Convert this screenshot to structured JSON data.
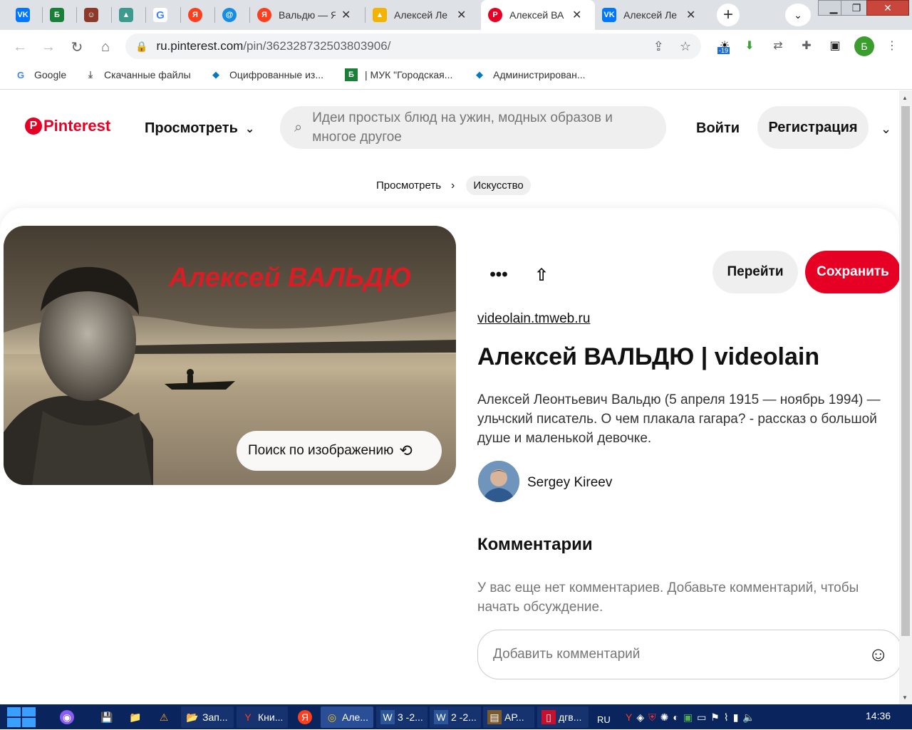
{
  "browser": {
    "tabs": [
      {
        "icon": "vk-icon",
        "label": "",
        "color": "#0077ff"
      },
      {
        "icon": "b-green-icon",
        "label": "",
        "color": "#1a7f37"
      },
      {
        "icon": "portrait-icon",
        "label": "",
        "color": "#8b3a2a"
      },
      {
        "icon": "landscape-icon",
        "label": "",
        "color": "#3c9a8f"
      },
      {
        "icon": "google-icon",
        "label": "",
        "color": "#4285f4"
      },
      {
        "icon": "yandex-icon",
        "label": "",
        "color": "#fc3f1d"
      },
      {
        "icon": "mail-at-icon",
        "label": "",
        "color": "#168de2"
      },
      {
        "icon": "yandex-icon",
        "label": "Вальдю — Я",
        "color": "#fc3f1d"
      },
      {
        "icon": "image-icon",
        "label": "Алексей Ле",
        "color": "#f2b400"
      },
      {
        "icon": "pinterest-icon",
        "label": "Алексей ВА",
        "color": "#e60023"
      },
      {
        "icon": "vk-icon",
        "label": "Алексей Ле",
        "color": "#0077ff"
      }
    ],
    "url_host": "ru.pinterest.com",
    "url_path": "/pin/362328732503803906/",
    "extension_badge": "-19",
    "profile_initial": "Б",
    "bookmarks": [
      {
        "icon": "google-icon",
        "label": "Google"
      },
      {
        "icon": "download-icon",
        "label": "Скачанные файлы"
      },
      {
        "icon": "drupal-icon",
        "label": "Оцифрованные из..."
      },
      {
        "icon": "b-green-icon",
        "label": "| МУК \"Городская..."
      },
      {
        "icon": "drupal-icon",
        "label": "Администрирован..."
      }
    ]
  },
  "pinterest": {
    "brand": "Pinterest",
    "explore_label": "Просмотреть",
    "search_placeholder": "Идеи простых блюд на ужин, модных образов и многое другое",
    "login_label": "Войти",
    "signup_label": "Регистрация",
    "breadcrumb": [
      "Просмотреть",
      "Искусство"
    ],
    "image_overlay_text": "Алексей ВАЛЬДЮ",
    "image_search_label": "Поиск по изображению",
    "goto_label": "Перейти",
    "save_label": "Сохранить",
    "source_link": "videolain.tmweb.ru",
    "pin_title": "Алексей ВАЛЬДЮ | videolain",
    "pin_description": "Алексей Леонтьевич Вальдю (5 апреля 1915 — ноябрь 1994) — ульчский писатель. О чем плакала гагара? - рассказ о большой душе и маленькой девочке.",
    "author": "Sergey Kireev",
    "comments_heading": "Комментарии",
    "no_comments_text": "У вас еще нет комментариев. Добавьте комментарий, чтобы начать обсуждение.",
    "add_comment_placeholder": "Добавить комментарий",
    "accent_color": "#e60023"
  },
  "taskbar": {
    "items": [
      {
        "icon": "folder-icon",
        "label": "Зап..."
      },
      {
        "icon": "yandex-browser-icon",
        "label": "Кни..."
      },
      {
        "icon": "yandex-icon",
        "label": ""
      },
      {
        "icon": "chrome-icon",
        "label": "Але..."
      },
      {
        "icon": "word-icon",
        "label": "3 -2..."
      },
      {
        "icon": "word-icon",
        "label": "2 -2..."
      },
      {
        "icon": "archive-icon",
        "label": "АР..."
      },
      {
        "icon": "pdf-icon",
        "label": "дгв..."
      }
    ],
    "language": "RU",
    "time": "14:36"
  }
}
